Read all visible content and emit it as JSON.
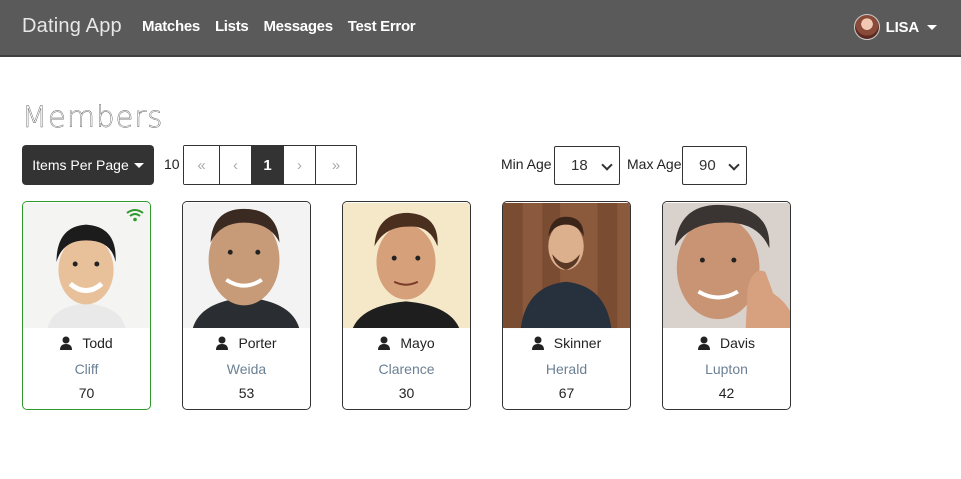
{
  "navbar": {
    "brand": "Dating App",
    "links": [
      "Matches",
      "Lists",
      "Messages",
      "Test Error"
    ],
    "user": "LISA"
  },
  "page": {
    "title": "Members"
  },
  "controls": {
    "items_per_page_label": "Items Per Page",
    "items_count": "10",
    "pagination": [
      "«",
      "‹",
      "1",
      "›",
      "»"
    ],
    "min_age_label": "Min Age",
    "min_age_value": "18",
    "max_age_label": "Max Age",
    "max_age_value": "90"
  },
  "members": [
    {
      "name": "Todd",
      "city": "Cliff",
      "age": "70",
      "online": true
    },
    {
      "name": "Porter",
      "city": "Weida",
      "age": "53",
      "online": false
    },
    {
      "name": "Mayo",
      "city": "Clarence",
      "age": "30",
      "online": false
    },
    {
      "name": "Skinner",
      "city": "Herald",
      "age": "67",
      "online": false
    },
    {
      "name": "Davis",
      "city": "Lupton",
      "age": "42",
      "online": false
    }
  ],
  "colors": {
    "navbar": "#5a5a5a",
    "online": "#2e9a2e",
    "city": "#6b8094"
  }
}
